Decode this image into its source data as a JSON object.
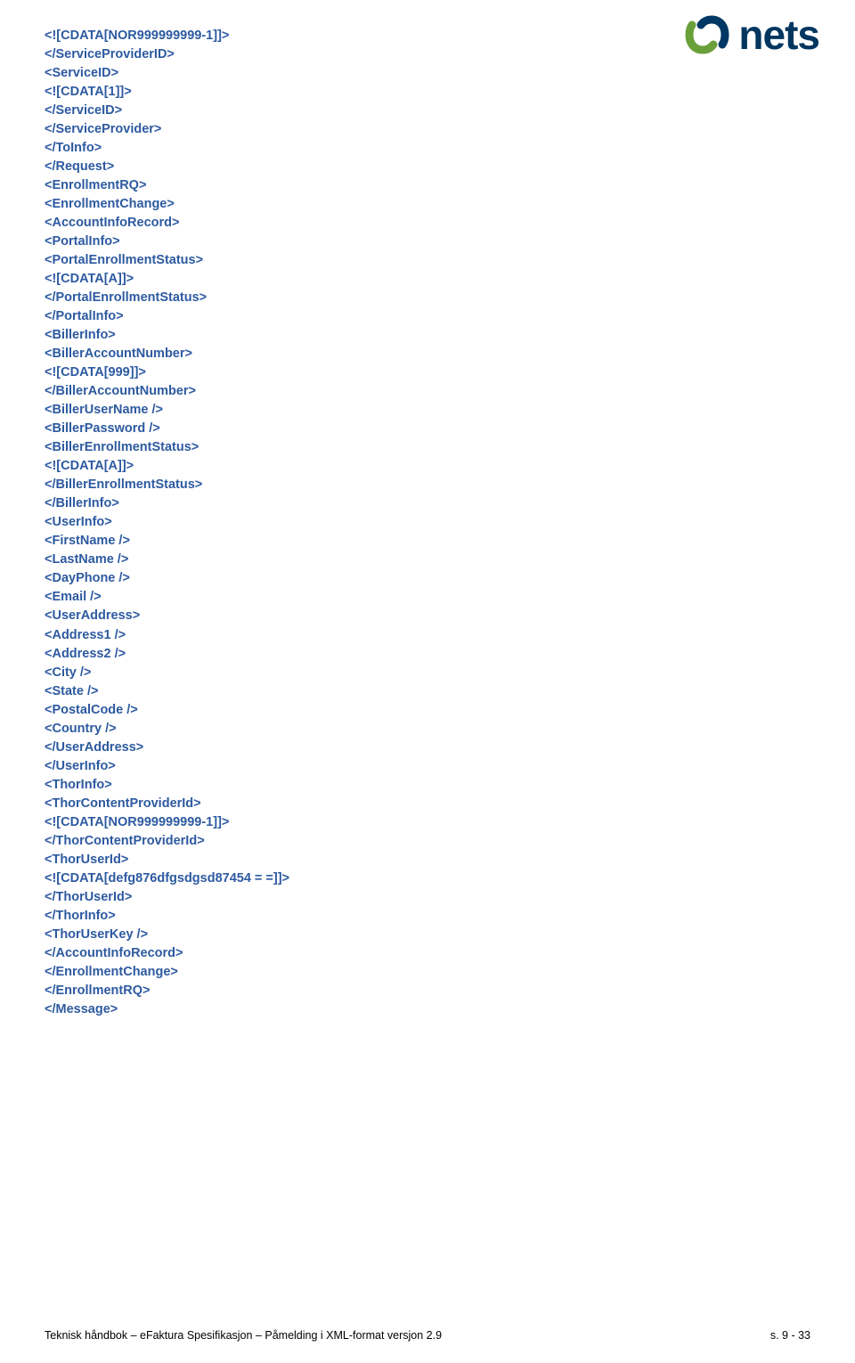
{
  "logo": {
    "text": "nets"
  },
  "xml": {
    "lines": [
      "<![CDATA[NOR999999999-1]]>",
      "</ServiceProviderID>",
      "<ServiceID>",
      "<![CDATA[1]]>",
      "</ServiceID>",
      "</ServiceProvider>",
      "</ToInfo>",
      "</Request>",
      "<EnrollmentRQ>",
      "<EnrollmentChange>",
      "<AccountInfoRecord>",
      "<PortalInfo>",
      "<PortalEnrollmentStatus>",
      "<![CDATA[A]]>",
      "</PortalEnrollmentStatus>",
      "</PortalInfo>",
      "<BillerInfo>",
      "<BillerAccountNumber>",
      "<![CDATA[999]]>",
      "</BillerAccountNumber>",
      "<BillerUserName />",
      "<BillerPassword />",
      "<BillerEnrollmentStatus>",
      "<![CDATA[A]]>",
      "</BillerEnrollmentStatus>",
      "</BillerInfo>",
      "<UserInfo>",
      "<FirstName />",
      "<LastName />",
      "<DayPhone />",
      "<Email />",
      "<UserAddress>",
      "<Address1 />",
      "<Address2 />",
      "<City />",
      "<State />",
      "<PostalCode />",
      "<Country />",
      "</UserAddress>",
      "</UserInfo>",
      "<ThorInfo>",
      "<ThorContentProviderId>",
      "<![CDATA[NOR999999999-1]]>",
      "</ThorContentProviderId>",
      "<ThorUserId>",
      "<![CDATA[defg876dfgsdgsd87454 = =]]>",
      "</ThorUserId>",
      "</ThorInfo>",
      "<ThorUserKey />",
      "</AccountInfoRecord>",
      "</EnrollmentChange>",
      "</EnrollmentRQ>",
      "</Message>"
    ]
  },
  "footer": {
    "left": "Teknisk håndbok – eFaktura  Spesifikasjon – Påmelding i XML-format versjon 2.9",
    "right": "s. 9 - 33"
  }
}
